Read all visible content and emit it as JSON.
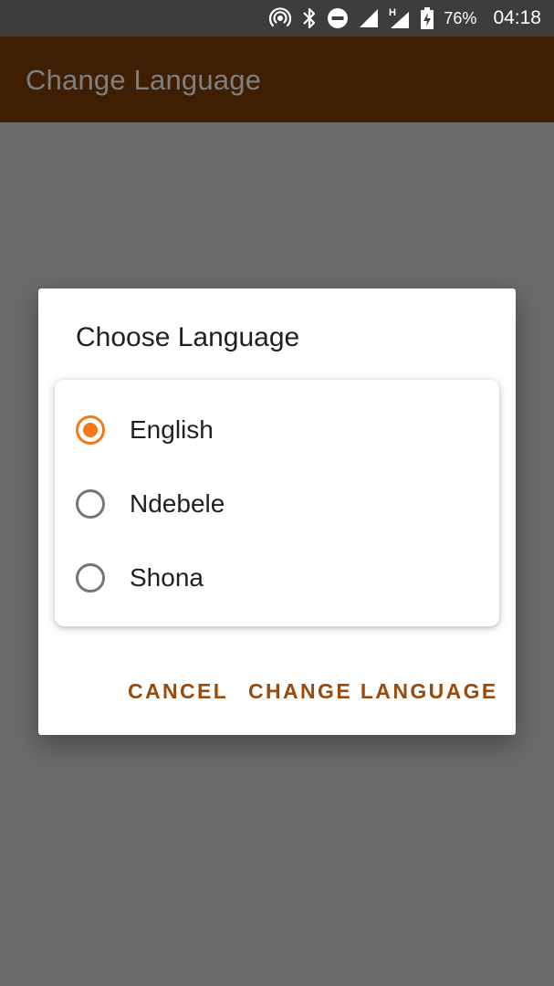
{
  "status_bar": {
    "battery_percent": "76%",
    "time": "04:18",
    "network_type": "H",
    "icons": [
      "hotspot-icon",
      "bluetooth-icon",
      "do-not-disturb-icon",
      "signal-icon",
      "signal-h-icon",
      "battery-charging-icon"
    ]
  },
  "app_bar": {
    "title": "Change Language"
  },
  "dialog": {
    "title": "Choose Language",
    "options": [
      {
        "label": "English",
        "selected": true
      },
      {
        "label": "Ndebele",
        "selected": false
      },
      {
        "label": "Shona",
        "selected": false
      }
    ],
    "cancel_label": "CANCEL",
    "confirm_label": "CHANGE LANGUAGE"
  },
  "colors": {
    "accent": "#f37a14",
    "button_text": "#9a4a0a",
    "app_bar": "#3f1f04",
    "scrim_background": "#6b6b6b"
  }
}
